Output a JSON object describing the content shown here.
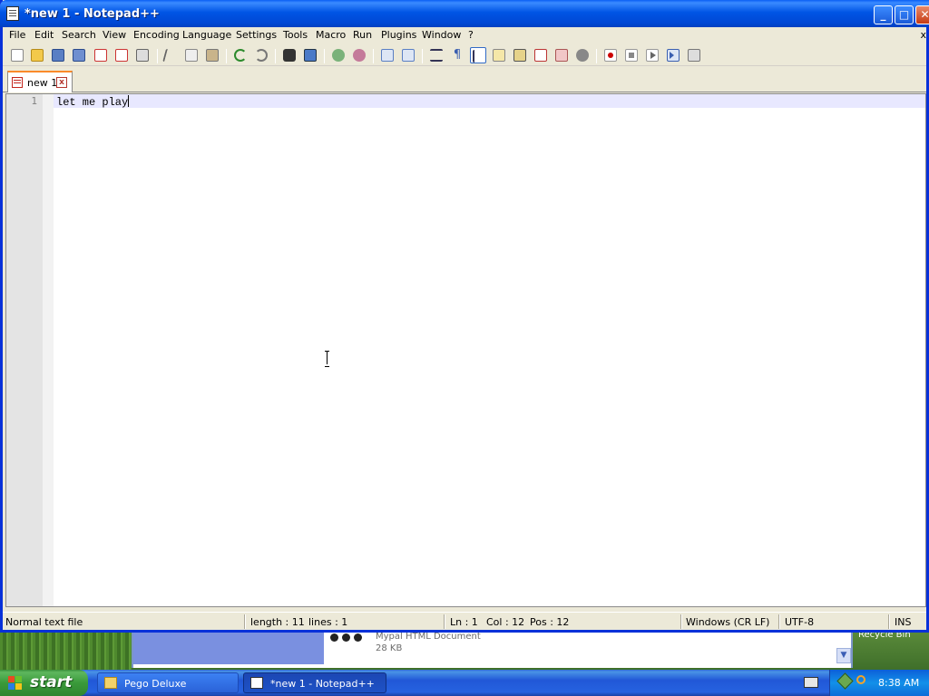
{
  "window": {
    "title": "*new 1 - Notepad++"
  },
  "menu": {
    "items": [
      "File",
      "Edit",
      "Search",
      "View",
      "Encoding",
      "Language",
      "Settings",
      "Tools",
      "Macro",
      "Run",
      "Plugins",
      "Window",
      "?"
    ],
    "close_glyph": "x"
  },
  "toolbar": {
    "icons": [
      "new-file-icon",
      "open-file-icon",
      "save-icon",
      "save-all-icon",
      "close-icon",
      "close-all-icon",
      "print-icon",
      "cut-icon",
      "copy-icon",
      "paste-icon",
      "undo-icon",
      "redo-icon",
      "find-icon",
      "replace-icon",
      "zoom-in-icon",
      "zoom-out-icon",
      "sync-vertical-icon",
      "sync-horizontal-icon",
      "word-wrap-icon",
      "show-all-characters-icon",
      "indent-guide-icon",
      "user-defined-language-icon",
      "document-map-icon",
      "function-list-icon",
      "folder-as-workspace-icon",
      "monitoring-icon",
      "record-macro-icon",
      "stop-recording-icon",
      "playback-icon",
      "run-macro-multiple-icon",
      "save-macro-icon"
    ]
  },
  "tabs": [
    {
      "label": "new 1",
      "close_glyph": "x"
    }
  ],
  "editor": {
    "line_number": "1",
    "text": "let me play"
  },
  "status": {
    "file_type": "Normal text file",
    "length": "length : 11",
    "lines": "lines : 1",
    "ln": "Ln : 1",
    "col": "Col : 12",
    "pos": "Pos : 12",
    "eol": "Windows (CR LF)",
    "encoding": "UTF-8",
    "mode": "INS"
  },
  "background_window": {
    "doc_type": "Mypal HTML Document",
    "doc_size": "28 KB",
    "recycle_label": "Recycle Bin"
  },
  "taskbar": {
    "start_label": "start",
    "buttons": [
      {
        "label": "Pego Deluxe"
      },
      {
        "label": "*new 1 - Notepad++"
      }
    ],
    "clock": "8:38 AM"
  },
  "colors": {
    "titlebar_blue": "#0055e5",
    "current_line": "#e8e8ff",
    "taskbar_blue": "#2157d7",
    "start_green": "#3a9a3a"
  }
}
